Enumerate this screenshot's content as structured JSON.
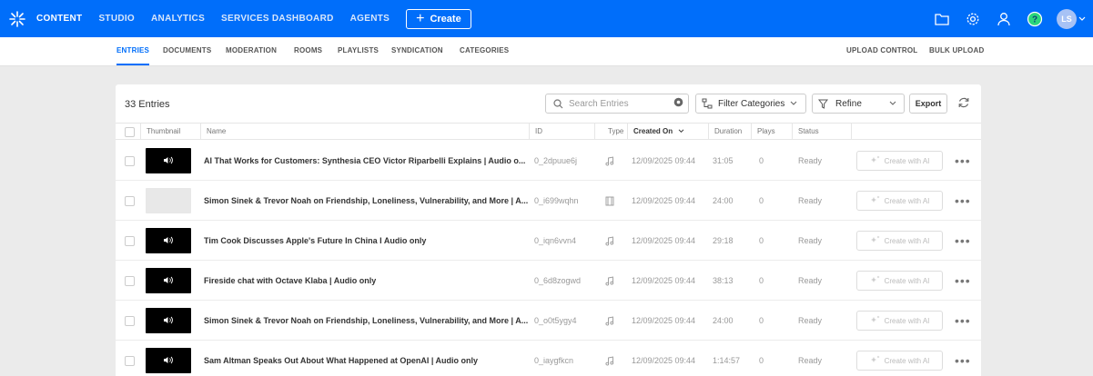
{
  "topnav": {
    "items": [
      {
        "name": "nav-content",
        "label": "CONTENT",
        "active": true
      },
      {
        "name": "nav-studio",
        "label": "STUDIO"
      },
      {
        "name": "nav-analytics",
        "label": "ANALYTICS"
      },
      {
        "name": "nav-services-dashboard",
        "label": "SERVICES DASHBOARD"
      },
      {
        "name": "nav-agents",
        "label": "AGENTS"
      }
    ],
    "create_label": "Create",
    "avatar_initials": "LS"
  },
  "subnav": {
    "tabs": [
      {
        "label": "ENTRIES",
        "active": true
      },
      {
        "label": "DOCUMENTS"
      },
      {
        "label": "MODERATION"
      },
      {
        "label": "ROOMS"
      },
      {
        "label": "PLAYLISTS"
      },
      {
        "label": "SYNDICATION"
      },
      {
        "label": "CATEGORIES"
      }
    ],
    "upload_control": "UPLOAD CONTROL",
    "bulk_upload": "BULK UPLOAD"
  },
  "toolbar": {
    "entries_count": "33 Entries",
    "search_placeholder": "Search Entries",
    "filter_categories": "Filter Categories",
    "refine": "Refine",
    "export": "Export"
  },
  "table": {
    "headers": {
      "thumbnail": "Thumbnail",
      "name": "Name",
      "id": "ID",
      "type": "Type",
      "created_on": "Created On",
      "duration": "Duration",
      "plays": "Plays",
      "status": "Status"
    },
    "create_with_ai": "Create with AI",
    "rows": [
      {
        "thumb": "black",
        "name": "AI That Works for Customers:  Synthesia CEO Victor Riparbelli Explains | Audio o...",
        "id": "0_2dpuue6j",
        "type": "audio",
        "created": "12/09/2025 09:44",
        "duration": "31:05",
        "plays": "0",
        "status": "Ready"
      },
      {
        "thumb": "gray",
        "name": "Simon Sinek & Trevor Noah on Friendship, Loneliness, Vulnerability, and More  |  A...",
        "id": "0_i699wqhn",
        "type": "video",
        "created": "12/09/2025 09:44",
        "duration": "24:00",
        "plays": "0",
        "status": "Ready"
      },
      {
        "thumb": "black",
        "name": "Tim Cook Discusses Apple's Future In China I Audio only",
        "id": "0_iqn6vvn4",
        "type": "audio",
        "created": "12/09/2025 09:44",
        "duration": "29:18",
        "plays": "0",
        "status": "Ready"
      },
      {
        "thumb": "black",
        "name": "Fireside chat with Octave Klaba | Audio only",
        "id": "0_6d8zogwd",
        "type": "audio",
        "created": "12/09/2025 09:44",
        "duration": "38:13",
        "plays": "0",
        "status": "Ready"
      },
      {
        "thumb": "black",
        "name": "Simon Sinek & Trevor Noah on Friendship, Loneliness, Vulnerability, and More  |  A...",
        "id": "0_o0t5ygy4",
        "type": "audio",
        "created": "12/09/2025 09:44",
        "duration": "24:00",
        "plays": "0",
        "status": "Ready"
      },
      {
        "thumb": "black",
        "name": "Sam Altman Speaks Out About What Happened at OpenAI  |  Audio only",
        "id": "0_iaygfkcn",
        "type": "audio",
        "created": "12/09/2025 09:44",
        "duration": "1:14:57",
        "plays": "0",
        "status": "Ready"
      }
    ]
  },
  "colors": {
    "brand": "#006efa"
  }
}
